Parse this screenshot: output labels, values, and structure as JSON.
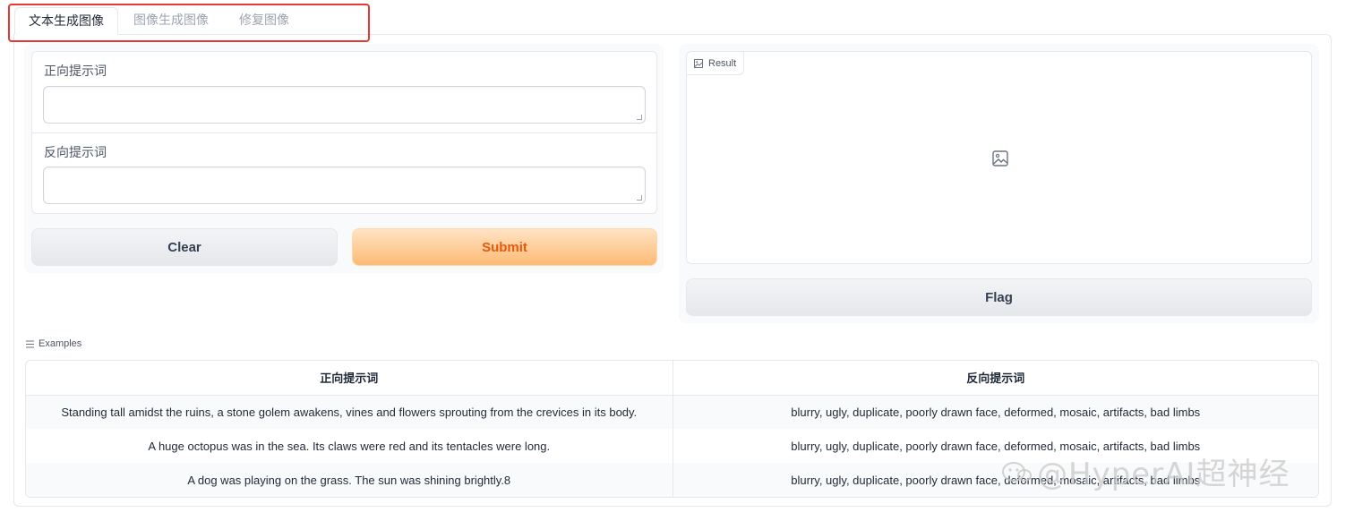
{
  "tabs": [
    {
      "label": "文本生成图像",
      "active": true
    },
    {
      "label": "图像生成图像",
      "active": false
    },
    {
      "label": "修复图像",
      "active": false
    }
  ],
  "form": {
    "positive_label": "正向提示词",
    "positive_value": "",
    "negative_label": "反向提示词",
    "negative_value": ""
  },
  "buttons": {
    "clear": "Clear",
    "submit": "Submit",
    "flag": "Flag"
  },
  "result": {
    "label": "Result",
    "icon": "image-icon"
  },
  "examples": {
    "title": "Examples",
    "headers": [
      "正向提示词",
      "反向提示词"
    ],
    "rows": [
      [
        "Standing tall amidst the ruins, a stone golem awakens, vines and flowers sprouting from the crevices in its body.",
        "blurry, ugly, duplicate, poorly drawn face, deformed, mosaic, artifacts, bad limbs"
      ],
      [
        "A huge octopus was in the sea. Its claws were red and its tentacles were long.",
        "blurry, ugly, duplicate, poorly drawn face, deformed, mosaic, artifacts, bad limbs"
      ],
      [
        "A dog was playing on the grass. The sun was shining brightly.8",
        "blurry, ugly, duplicate, poorly drawn face, deformed, mosaic, artifacts, bad limbs"
      ]
    ]
  },
  "watermark": "@HyperAI超神经",
  "colors": {
    "accent": "#ea580c",
    "highlight": "#e53935"
  }
}
